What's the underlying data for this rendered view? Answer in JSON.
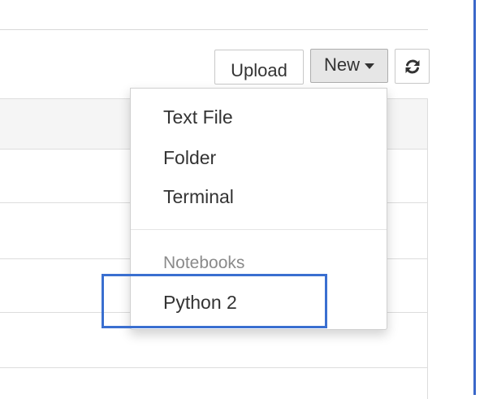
{
  "toolbar": {
    "upload_label": "Upload",
    "new_label": "New",
    "new_caret_icon": "caret-down-icon",
    "refresh_icon": "refresh-icon"
  },
  "new_menu": {
    "items": [
      {
        "label": "Text File"
      },
      {
        "label": "Folder"
      },
      {
        "label": "Terminal"
      }
    ],
    "notebooks_header": "Notebooks",
    "notebook_kernels": [
      {
        "label": "Python 2",
        "highlighted": true
      }
    ]
  },
  "colors": {
    "highlight_border": "#3a6fd0",
    "window_border": "#3a67c9",
    "menu_text": "#333333",
    "menu_header_text": "#8a8a8a"
  }
}
